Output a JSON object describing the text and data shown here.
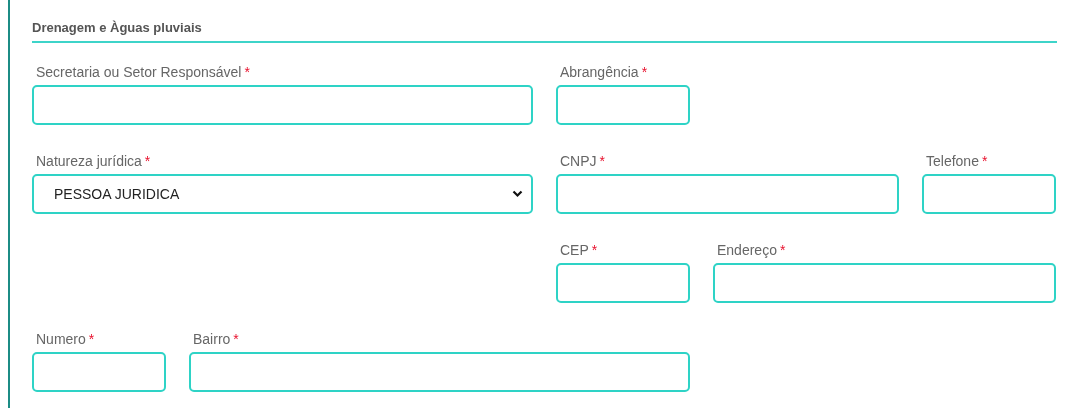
{
  "section": {
    "title": "Drenagem e Àguas pluviais"
  },
  "rows": [
    [
      {
        "label": "Secretaria ou Setor Responsável",
        "required_mark": "*",
        "kind": "text"
      },
      {
        "label": "Abrangência",
        "required_mark": "*",
        "kind": "text"
      }
    ],
    [
      {
        "label": "Natureza jurídica",
        "required_mark": "*",
        "kind": "select",
        "value": "PESSOA JURIDICA"
      },
      {
        "label": "CNPJ",
        "required_mark": "*",
        "kind": "text"
      },
      {
        "label": "Telefone",
        "required_mark": "*",
        "kind": "text"
      }
    ],
    [
      {
        "label": "CEP",
        "required_mark": "*",
        "kind": "text"
      },
      {
        "label": "Endereço",
        "required_mark": "*",
        "kind": "text"
      }
    ],
    [
      {
        "label": "Numero",
        "required_mark": "*",
        "kind": "text"
      },
      {
        "label": "Bairro",
        "required_mark": "*",
        "kind": "text"
      }
    ]
  ]
}
